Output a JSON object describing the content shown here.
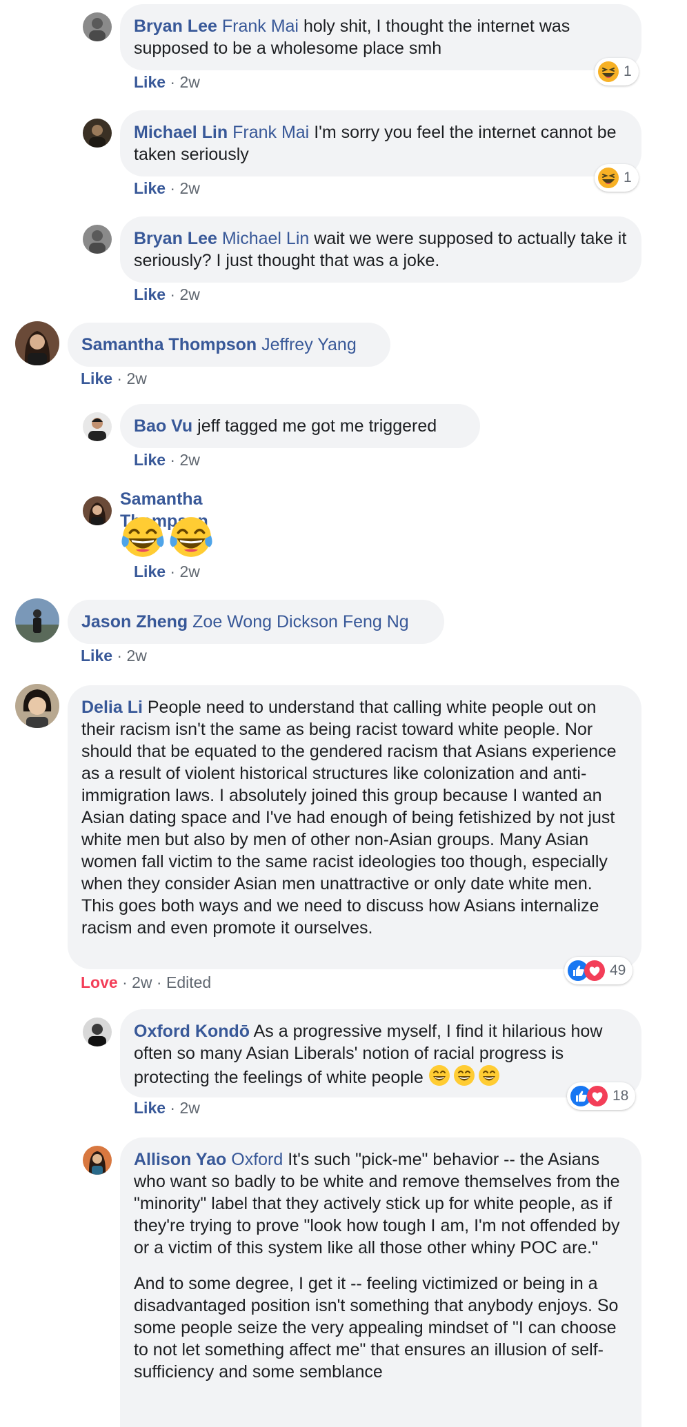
{
  "comments": [
    {
      "author": "Bryan Lee",
      "tag": "Frank Mai",
      "text": "holy shit, I thought the internet was supposed to be a wholesome place smh",
      "reaction_count": "1",
      "action": "Like",
      "time": "2w"
    },
    {
      "author": "Michael Lin",
      "tag": "Frank Mai",
      "text": "I'm sorry you feel the internet cannot be taken seriously",
      "reaction_count": "1",
      "action": "Like",
      "time": "2w"
    },
    {
      "author": "Bryan Lee",
      "tag": "Michael Lin",
      "text": "wait we were supposed to actually take it seriously? I just thought that was a joke.",
      "action": "Like",
      "time": "2w"
    },
    {
      "author": "Samantha Thompson",
      "tag": "Jeffrey Yang",
      "action": "Like",
      "time": "2w"
    },
    {
      "author": "Bao Vu",
      "text": "jeff tagged me got me triggered",
      "action": "Like",
      "time": "2w"
    },
    {
      "author": "Samantha Thompson",
      "emoji": "tears-of-joy",
      "action": "Like",
      "time": "2w"
    },
    {
      "author": "Jason Zheng",
      "tag": "Zoe Wong Dickson Feng Ng",
      "action": "Like",
      "time": "2w"
    },
    {
      "author": "Delia Li",
      "text": "People need to understand that calling white people out on their racism isn't the same as being racist toward white people. Nor should that be equated to the gendered racism that Asians experience as a result of violent historical structures like colonization and anti-immigration laws. I absolutely joined this group because I wanted an Asian dating space and I've had enough of being fetishized by not just white men but also by men of other non-Asian groups. Many Asian women fall victim to the same racist ideologies too though, especially when they consider Asian men unattractive or only date white men. This goes both ways and we need to discuss how Asians internalize racism and even promote it ourselves.",
      "reaction_count": "49",
      "action": "Love",
      "time": "2w",
      "edited": "Edited"
    },
    {
      "author": "Oxford Kondō",
      "text": "As a progressive myself, I find it hilarious how often so many Asian Liberals' notion of racial progress is protecting the feelings of white people",
      "reaction_count": "18",
      "action": "Like",
      "time": "2w"
    },
    {
      "author": "Allison Yao",
      "tag": "Oxford",
      "text": "It's such \"pick-me\" behavior -- the Asians who want so badly to be white and remove themselves from the \"minority\" label that they actively stick up for white people, as if they're trying to prove \"look how tough I am, I'm not offended by or a victim of this system like all those other whiny POC are.\"",
      "text2": "And to some degree, I get it -- feeling victimized or being in a disadvantaged position isn't something that anybody enjoys. So some people seize the very appealing mindset of \"I can choose to not let something affect me\" that ensures an illusion of self-sufficiency and some semblance"
    }
  ],
  "separator": " · ",
  "colors": {
    "link": "#385898",
    "bubble": "#f2f3f5",
    "meta": "#606770",
    "love": "#f33e58",
    "like_blue": "#1877f2"
  },
  "icons": [
    "haha-icon",
    "like-icon",
    "love-icon",
    "tears-of-joy-emoji",
    "grinning-emoji"
  ]
}
